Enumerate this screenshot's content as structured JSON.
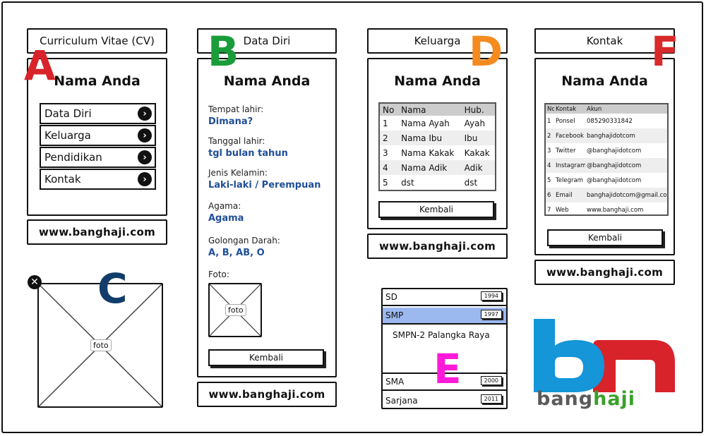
{
  "colors": {
    "blue_text": "#1f4e99",
    "letter_a": "#d8232a",
    "letter_b": "#1a9c3a",
    "letter_c": "#123d6b",
    "letter_d": "#f58a1f",
    "letter_e": "#ff1ad9",
    "letter_f": "#d82a2a",
    "selected_row": "#9bb8ef",
    "logo_blue": "#1496d8",
    "logo_red": "#d8232a",
    "logo_gray": "#5a5a5a",
    "logo_green": "#3aa02a"
  },
  "panel_a": {
    "title": "Curriculum Vitae (CV)",
    "name": "Nama Anda",
    "menu": [
      {
        "label": "Data Diri",
        "icon": "chevron-right-icon"
      },
      {
        "label": "Keluarga",
        "icon": "chevron-right-icon"
      },
      {
        "label": "Pendidikan",
        "icon": "chevron-right-icon"
      },
      {
        "label": "Kontak",
        "icon": "chevron-right-icon"
      }
    ],
    "url": "www.banghaji.com",
    "letter": "A"
  },
  "panel_b": {
    "title": "Data Diri",
    "name": "Nama Anda",
    "fields": [
      {
        "label": "Tempat lahir:",
        "value": "Dimana?"
      },
      {
        "label": "Tanggal lahir:",
        "value": "tgl bulan tahun"
      },
      {
        "label": "Jenis Kelamin:",
        "value": "Laki-laki / Perempuan"
      },
      {
        "label": "Agama:",
        "value": "Agama"
      },
      {
        "label": "Golongan Darah:",
        "value": "A, B, AB, O"
      }
    ],
    "photo_label": "Foto:",
    "photo_placeholder": "foto",
    "back_button": "Kembali",
    "url": "www.banghaji.com",
    "letter": "B"
  },
  "panel_c": {
    "placeholder": "foto",
    "letter": "C",
    "close_icon": "close-icon"
  },
  "panel_d": {
    "title": "Keluarga",
    "name": "Nama Anda",
    "headers": [
      "No",
      "Nama",
      "Hub."
    ],
    "rows": [
      [
        "1",
        "Nama Ayah",
        "Ayah"
      ],
      [
        "2",
        "Nama Ibu",
        "Ibu"
      ],
      [
        "3",
        "Nama Kakak",
        "Kakak"
      ],
      [
        "4",
        "Nama Adik",
        "Adik"
      ],
      [
        "5",
        "dst",
        "dst"
      ]
    ],
    "back_button": "Kembali",
    "url": "www.banghaji.com",
    "letter": "D"
  },
  "panel_e": {
    "items": [
      {
        "label": "SD",
        "year": "1994"
      },
      {
        "label": "SMP",
        "year": "1997",
        "detail": "SMPN-2 Palangka Raya"
      },
      {
        "label": "SMA",
        "year": "2000"
      },
      {
        "label": "Sarjana",
        "year": "2011"
      }
    ],
    "letter": "E"
  },
  "panel_f": {
    "title": "Kontak",
    "name": "Nama Anda",
    "headers": [
      "No",
      "Kontak",
      "Akun"
    ],
    "rows": [
      [
        "1",
        "Ponsel",
        "085290331842"
      ],
      [
        "2",
        "Facebook",
        "banghajidotcom"
      ],
      [
        "3",
        "Twitter",
        "@banghajidotcom"
      ],
      [
        "4",
        "Instagram",
        "@banghajidotcom"
      ],
      [
        "5",
        "Telegram",
        "@banghajidotcom"
      ],
      [
        "6",
        "Email",
        "banghajidotcom@gmail.com"
      ],
      [
        "7",
        "Web",
        "www.banghaji.com"
      ]
    ],
    "back_button": "Kembali",
    "url": "www.banghaji.com",
    "letter": "F"
  },
  "logo": {
    "part1": "bang",
    "part2": "haji"
  }
}
